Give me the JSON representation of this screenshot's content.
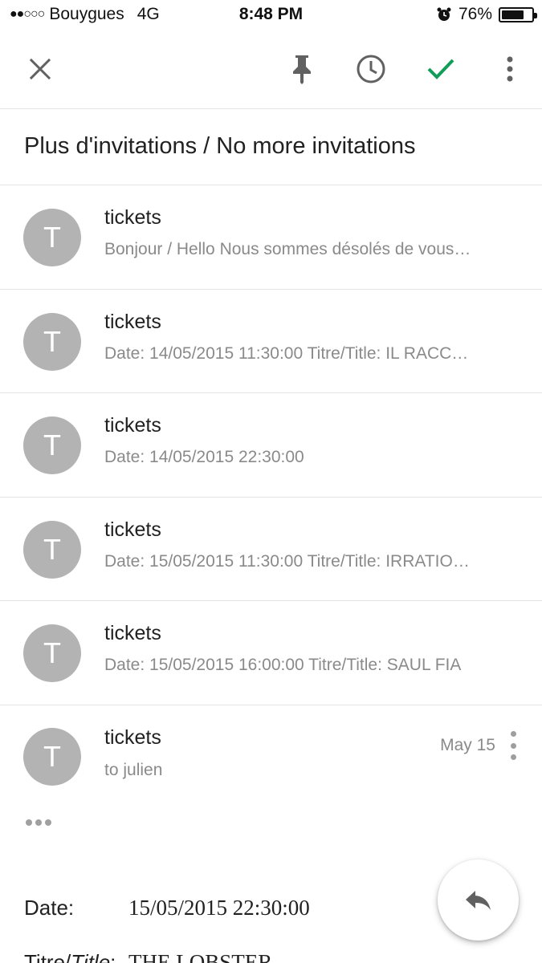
{
  "status_bar": {
    "signal_dots": "●●○○○",
    "carrier": "Bouygues",
    "network": "4G",
    "time": "8:48 PM",
    "battery_pct": "76%",
    "battery_level": 0.76,
    "alarm_icon": "alarm-clock-icon"
  },
  "toolbar": {
    "close_icon": "close-icon",
    "pin_icon": "pin-icon",
    "snooze_icon": "clock-icon",
    "done_icon": "check-icon",
    "more_icon": "more-vert-icon",
    "accent_color": "#0f9d58"
  },
  "subject": "Plus d'invitations / No more invitations",
  "messages": [
    {
      "avatar_letter": "T",
      "sender": "tickets",
      "snippet": "Bonjour / Hello Nous sommes désolés de vous…"
    },
    {
      "avatar_letter": "T",
      "sender": "tickets",
      "snippet": "Date: 14/05/2015 11:30:00 Titre/Title: IL RACC…"
    },
    {
      "avatar_letter": "T",
      "sender": "tickets",
      "snippet": "Date: 14/05/2015 22:30:00"
    },
    {
      "avatar_letter": "T",
      "sender": "tickets",
      "snippet": "Date: 15/05/2015 11:30:00 Titre/Title: IRRATIO…"
    },
    {
      "avatar_letter": "T",
      "sender": "tickets",
      "snippet": "Date: 15/05/2015 16:00:00 Titre/Title: SAUL FIA"
    }
  ],
  "expanded": {
    "avatar_letter": "T",
    "sender": "tickets",
    "to_line": "to julien",
    "date": "May 15",
    "body": {
      "date_label": "Date:",
      "date_value": "15/05/2015 22:30:00",
      "title_label_fr": "Titre/",
      "title_label_en": "Title",
      "title_label_colon": ":",
      "title_value": "THE LOBSTER"
    }
  },
  "fab": {
    "icon": "reply-icon"
  }
}
